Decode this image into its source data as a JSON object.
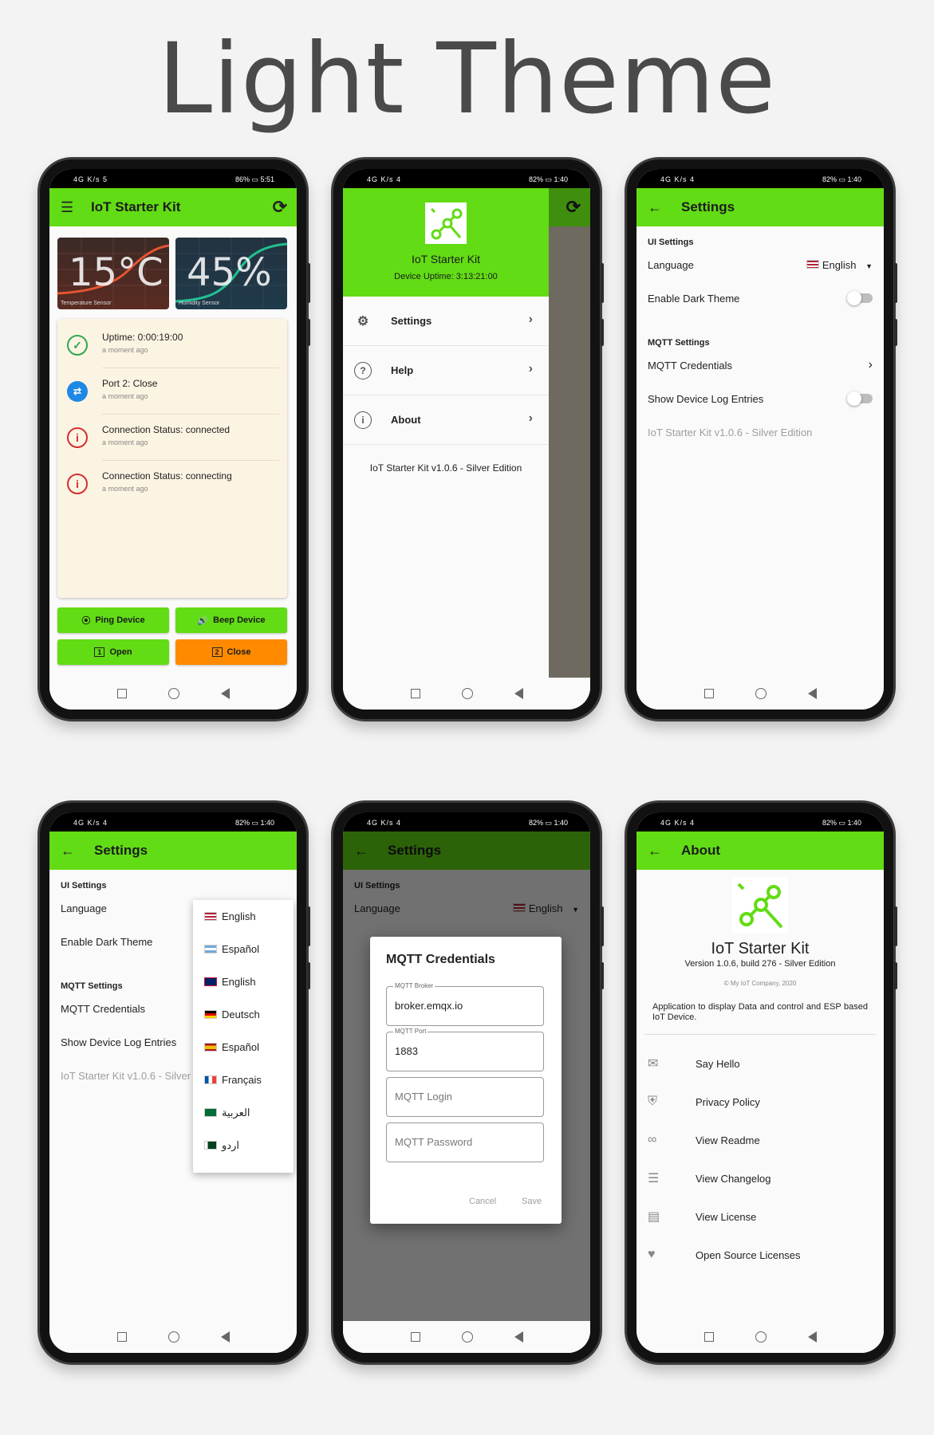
{
  "page_title": "Light Theme",
  "app_name": "IoT Starter Kit",
  "version_text": "IoT Starter Kit v1.0.6 - Silver Edition",
  "colors": {
    "accent": "#62dc14",
    "orange": "#ff8a00",
    "bg": "#f3f3f3"
  },
  "phone1": {
    "status_left": "4G K/s 5",
    "status_right": "86% ▭ 5:51",
    "title": "IoT Starter Kit",
    "temp_value": "15°C",
    "temp_caption": "Temperature Sensor",
    "hum_value": "45%",
    "hum_caption": "Humidity Sensor",
    "events": [
      {
        "title": "Uptime: 0:00:19:00",
        "sub": "a moment ago",
        "icon": "alarm-check-icon"
      },
      {
        "title": "Port 2: Close",
        "sub": "a moment ago",
        "icon": "swap-icon"
      },
      {
        "title": "Connection Status: connected",
        "sub": "a moment ago",
        "icon": "info-icon"
      },
      {
        "title": "Connection Status: connecting",
        "sub": "a moment ago",
        "icon": "info-icon"
      }
    ],
    "btn_ping": "Ping Device",
    "btn_beep": "Beep Device",
    "btn_open": "Open",
    "btn_close": "Close"
  },
  "phone2": {
    "status_left": "4G K/s 4",
    "status_right": "82% ▭ 1:40",
    "drawer_title": "IoT Starter Kit",
    "drawer_uptime": "Device Uptime: 3:13:21:00",
    "items": [
      {
        "label": "Settings",
        "icon": "gear-icon"
      },
      {
        "label": "Help",
        "icon": "help-icon"
      },
      {
        "label": "About",
        "icon": "info-icon"
      }
    ],
    "footer": "IoT Starter Kit v1.0.6 - Silver Edition"
  },
  "settings": {
    "title": "Settings",
    "ui_section": "UI Settings",
    "language_label": "Language",
    "language_value": "English",
    "dark_theme_label": "Enable Dark Theme",
    "mqtt_section": "MQTT Settings",
    "mqtt_credentials": "MQTT Credentials",
    "device_log_label": "Show Device Log Entries",
    "footer": "IoT Starter Kit v1.0.6 - Silver Edition",
    "footer_cut": "IoT Starter Kit v1.0.6 - Silver"
  },
  "status_settings": {
    "left": "4G K/s 4",
    "right": "82% ▭ 1:40"
  },
  "languages": [
    "English",
    "Español",
    "English",
    "Deutsch",
    "Español",
    "Français",
    "العربية",
    "اردو"
  ],
  "dialog": {
    "title": "MQTT Credentials",
    "broker_label": "MQTT Broker",
    "broker_value": "broker.emqx.io",
    "port_label": "MQTT Port",
    "port_value": "1883",
    "login_placeholder": "MQTT Login",
    "password_placeholder": "MQTT Password",
    "cancel": "Cancel",
    "save": "Save"
  },
  "about": {
    "title": "About",
    "app": "IoT Starter Kit",
    "version": "Version 1.0.6, build 276 - Silver Edition",
    "copyright": "© My IoT Company, 2020",
    "description": "Application to display Data and control and ESP based IoT Device.",
    "items": [
      {
        "label": "Say Hello",
        "icon": "mail-icon"
      },
      {
        "label": "Privacy Policy",
        "icon": "shield-icon"
      },
      {
        "label": "View Readme",
        "icon": "link-icon"
      },
      {
        "label": "View Changelog",
        "icon": "list-icon"
      },
      {
        "label": "View License",
        "icon": "document-icon"
      },
      {
        "label": "Open Source Licenses",
        "icon": "heart-icon"
      }
    ]
  }
}
